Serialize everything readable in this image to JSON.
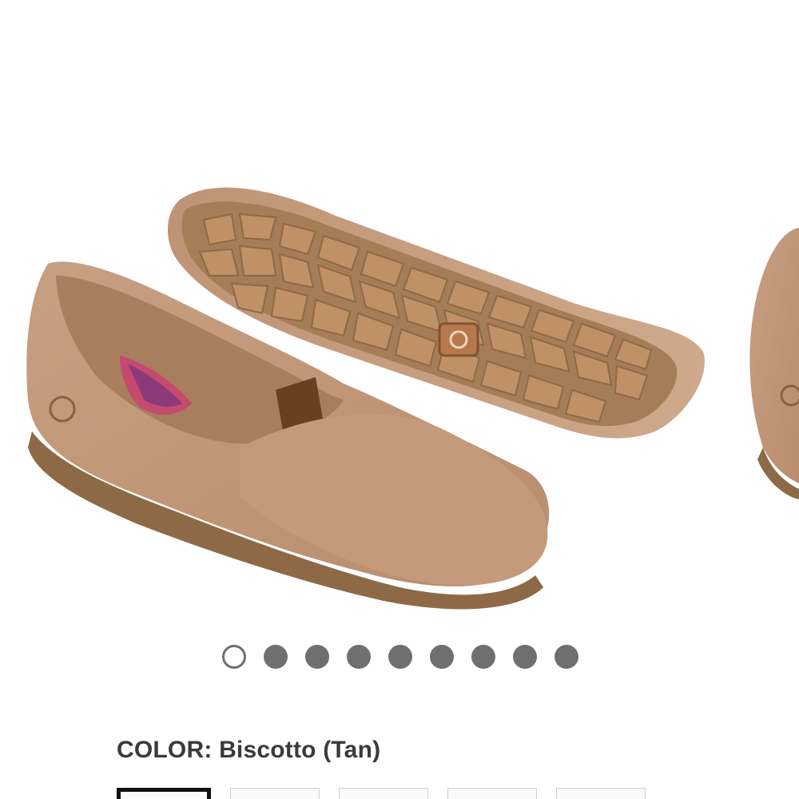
{
  "product_image": {
    "icon": "product-photo-tan-loafers"
  },
  "carousel": {
    "total": 9,
    "active_index": 0,
    "colors": {
      "active_border": "#6f6f6f",
      "inactive": "#6f6f6f"
    }
  },
  "color_selector": {
    "label": "COLOR:",
    "value": "Biscotto (Tan)",
    "swatches_visible": 5,
    "selected_index": 0
  },
  "colors": {
    "leather": "#c69c7c",
    "sole": "#9a7550",
    "text": "#3a3a3a"
  }
}
